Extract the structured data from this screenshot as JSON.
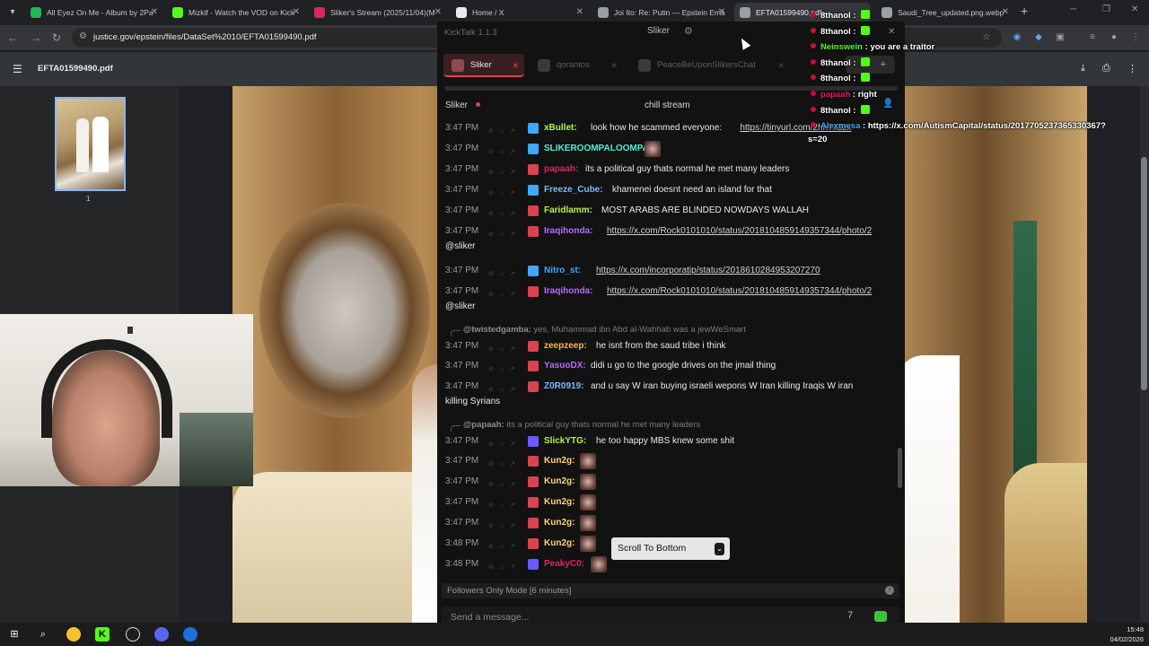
{
  "browser": {
    "tabs": [
      {
        "title": "All Eyez On Me - Album by 2Pa",
        "favicon_color": "#1db954",
        "active": false
      },
      {
        "title": "Mizkif - Watch the VOD on Kick",
        "favicon_color": "#53fc18",
        "active": false
      },
      {
        "title": "Sliker's Stream (2025/11/04)(M",
        "favicon_color": "#e0245e",
        "active": false
      },
      {
        "title": "Home / X",
        "favicon_color": "#e8eaed",
        "active": false
      },
      {
        "title": "Joi Ito: Re: Putin — Epstein Ema",
        "favicon_color": "#9aa0a6",
        "active": false
      },
      {
        "title": "EFTA01599490.pdf",
        "favicon_color": "#9aa0a6",
        "active": true
      },
      {
        "title": "Saudi_Tree_updated.png.webp",
        "favicon_color": "#9aa0a6",
        "active": false
      }
    ],
    "url": "justice.gov/epstein/files/DataSet%2010/EFTA01599490.pdf"
  },
  "pdf": {
    "filename": "EFTA01599490.pdf",
    "page_number": "1"
  },
  "kicktalk": {
    "app_title": "KickTalk 1.1.3",
    "current_user": "Sliker",
    "tabs": [
      {
        "label": "Sliker",
        "active": true
      },
      {
        "label": "qorantos",
        "active": false
      },
      {
        "label": "PeaceBeUponSlikersChat",
        "active": false
      }
    ],
    "channel": "Sliker",
    "stream_title": "chill stream",
    "messages": [
      {
        "time": "3:47 PM",
        "user": "xBullet:",
        "color": "#b7f04a",
        "badge": "#3fa7ff",
        "text": "look how he scammed everyone:",
        "link": "https://tinyurl.com/2hh7x3zx"
      },
      {
        "time": "3:47 PM",
        "user": "SLIKEROOMPALOOMPA:",
        "color": "#4ff0d2",
        "badge": "#3fa7ff",
        "text": ""
      },
      {
        "time": "3:47 PM",
        "user": "papaah:",
        "color": "#e0245e",
        "badge": "#d9434f",
        "text": "its a political guy thats normal he met many leaders"
      },
      {
        "time": "3:47 PM",
        "user": "Freeze_Cube:",
        "color": "#7fb6ff",
        "badge": "#3fa7ff",
        "text": "khamenei doesnt need an island for that"
      },
      {
        "time": "3:47 PM",
        "user": "Faridlamm:",
        "color": "#b7f04a",
        "badge": "#d9434f",
        "text": "MOST ARABS ARE BLINDED NOWDAYS WALLAH"
      },
      {
        "time": "3:47 PM",
        "user": "Iraqihonda:",
        "color": "#b36bff",
        "badge": "#d9434f",
        "text": "",
        "link": "https://x.com/Rock0101010/status/2018104859149357344/photo/2",
        "wrap": "@sliker"
      },
      {
        "time": "3:47 PM",
        "user": "Nitro_st:",
        "color": "#3fa7ff",
        "badge": "#3fa7ff",
        "text": "",
        "link": "https://x.com/incorporatip/status/2018610284953207270"
      },
      {
        "time": "3:47 PM",
        "user": "Iraqihonda:",
        "color": "#b36bff",
        "badge": "#d9434f",
        "text": "",
        "link": "https://x.com/Rock0101010/status/2018104859149357344/photo/2",
        "wrap": "@sliker"
      },
      {
        "time": "3:47 PM",
        "user": "zeepzeep:",
        "color": "#ffb347",
        "badge": "#d9434f",
        "text": "he isnt from the saud tribe i think",
        "reply": {
          "user": "@twistedgamba:",
          "text": "yes, Muhammad ibn Abd al-Wahhab was a jewWeSmart"
        }
      },
      {
        "time": "3:47 PM",
        "user": "YasuoDX:",
        "color": "#b36bff",
        "badge": "#d9434f",
        "text": "didi u go to the google drives on the jmail thing"
      },
      {
        "time": "3:47 PM",
        "user": "Z0R0919:",
        "color": "#7fb6ff",
        "badge": "#d9434f",
        "text": "and u say W iran buying israeli wepons W Iran killing Iraqis W iran",
        "wrap": "killing Syrians"
      },
      {
        "time": "3:47 PM",
        "user": "SlickYTG:",
        "color": "#b7f04a",
        "badge": "#6a5aff",
        "text": "he too happy MBS knew some shit",
        "reply": {
          "user": "@papaah:",
          "text": "its a political guy thats normal he met many leaders"
        }
      },
      {
        "time": "3:47 PM",
        "user": "Kun2g:",
        "color": "#ffd27a",
        "badge": "#d9434f",
        "text": ""
      },
      {
        "time": "3:47 PM",
        "user": "Kun2g:",
        "color": "#ffd27a",
        "badge": "#d9434f",
        "text": ""
      },
      {
        "time": "3:47 PM",
        "user": "Kun2g:",
        "color": "#ffd27a",
        "badge": "#d9434f",
        "text": ""
      },
      {
        "time": "3:47 PM",
        "user": "Kun2g:",
        "color": "#ffd27a",
        "badge": "#d9434f",
        "text": ""
      },
      {
        "time": "3:48 PM",
        "user": "Kun2g:",
        "color": "#ffd27a",
        "badge": "#d9434f",
        "text": ""
      },
      {
        "time": "3:48 PM",
        "user": "PeakyC0:",
        "color": "#e0245e",
        "badge": "#6a5aff",
        "text": ""
      }
    ],
    "scroll_to_bottom": "Scroll To Bottom",
    "followers_mode": "Followers Only Mode [6 minutes]",
    "input_placeholder": "Send a message..."
  },
  "overlay_chat": [
    {
      "user": "8thanol",
      "color": "#ffffff",
      "text": ""
    },
    {
      "user": "8thanol",
      "color": "#ffffff",
      "text": ""
    },
    {
      "user": "Neinswein",
      "color": "#53fc18",
      "text": "you are a traitor"
    },
    {
      "user": "8thanol",
      "color": "#ffffff",
      "text": ""
    },
    {
      "user": "8thanol",
      "color": "#ffffff",
      "text": ""
    },
    {
      "user": "papaah",
      "color": "#e0245e",
      "text": "right"
    },
    {
      "user": "8thanol",
      "color": "#ffffff",
      "text": ""
    },
    {
      "user": "Alexmesa",
      "color": "#3fa7ff",
      "text": "https://x.com/AutismCapital/status/2017705237365330367?",
      "wrap": "s=20"
    }
  ],
  "clock": {
    "time": "15:48",
    "date": "04/02/2026"
  }
}
